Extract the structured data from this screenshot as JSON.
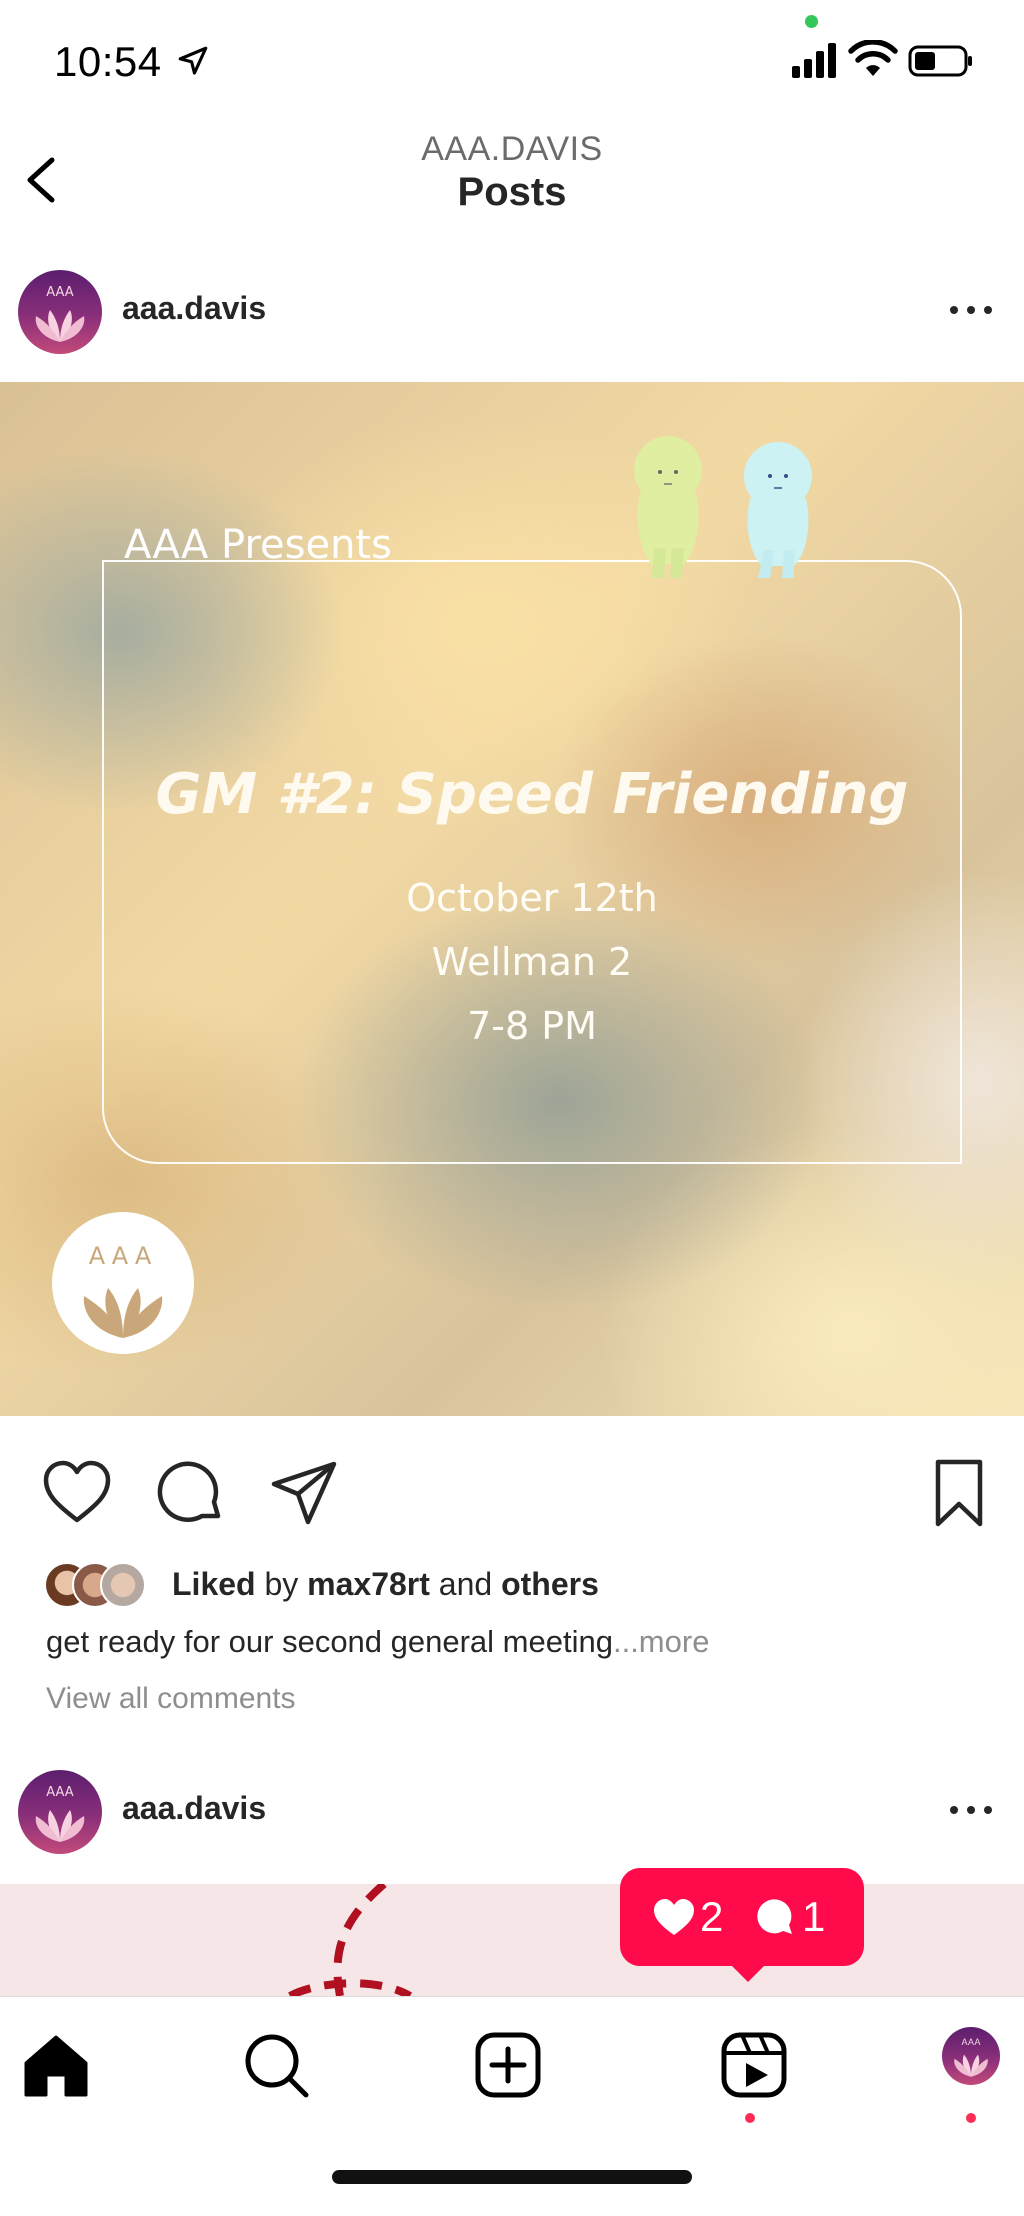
{
  "status_bar": {
    "time": "10:54",
    "icons": [
      "location-arrow-icon",
      "signal-icon",
      "wifi-icon",
      "battery-icon"
    ]
  },
  "header": {
    "subtitle": "AAA.DAVIS",
    "title": "Posts"
  },
  "post1": {
    "username": "aaa.davis",
    "image": {
      "presents": "AAA Presents",
      "title": "GM #2: Speed Friending",
      "date": "October 12th",
      "location": "Wellman 2",
      "time": "7-8 PM",
      "logo_text": "AAA"
    },
    "likes": {
      "liked": "Liked",
      "by": " by ",
      "user": "max78rt",
      "and": " and ",
      "others": "others"
    },
    "caption": "get ready for our second general meeting",
    "caption_more": "...more",
    "view_comments": "View all comments"
  },
  "post2": {
    "username": "aaa.davis"
  },
  "notification": {
    "likes": "2",
    "comments": "1"
  },
  "avatar_text": "AAA",
  "colors": {
    "accent": "#ff0a4b",
    "dot": "#ff2d55",
    "avatar_top": "#5b1e6e",
    "avatar_bottom": "#c24a7a",
    "logo_tan": "#c9a77a"
  }
}
